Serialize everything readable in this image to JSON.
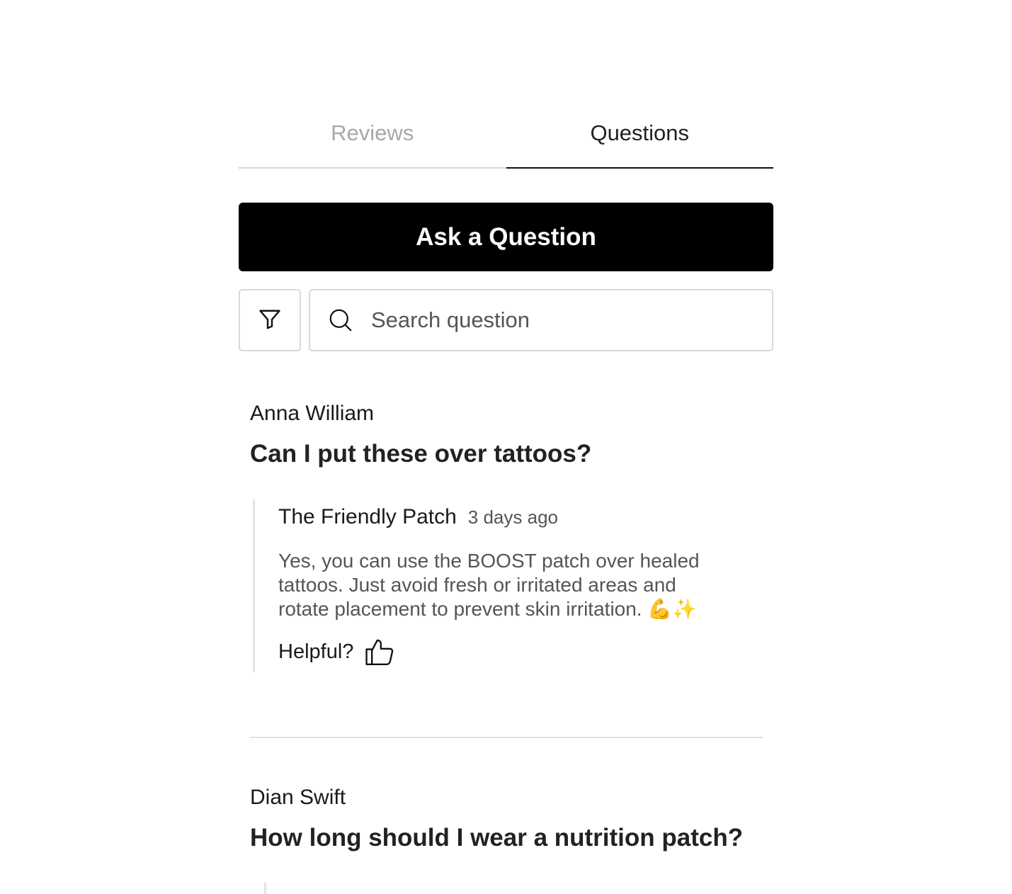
{
  "tabs": [
    {
      "label": "Reviews",
      "active": false
    },
    {
      "label": "Questions",
      "active": true
    }
  ],
  "ask_button": {
    "label": "Ask a Question"
  },
  "search": {
    "placeholder": "Search question"
  },
  "questions": [
    {
      "author": "Anna William",
      "title": "Can I put these over tattoos?",
      "answer": {
        "author": "The Friendly Patch",
        "time": "3 days ago",
        "body": "Yes, you can use the BOOST patch over healed tattoos. Just avoid fresh or irritated areas and rotate placement to prevent skin irritation. 💪✨",
        "helpful_label": "Helpful?"
      }
    },
    {
      "author": "Dian Swift",
      "title": "How long should I wear a nutrition patch?"
    }
  ],
  "colors": {
    "primary": "#000000",
    "tab_inactive": "#a8a8a8",
    "border": "#d9d9d9",
    "muted_text": "#555555"
  },
  "icons": {
    "filter": "funnel-icon",
    "search": "magnifier-icon",
    "helpful": "thumbs-up-icon"
  }
}
